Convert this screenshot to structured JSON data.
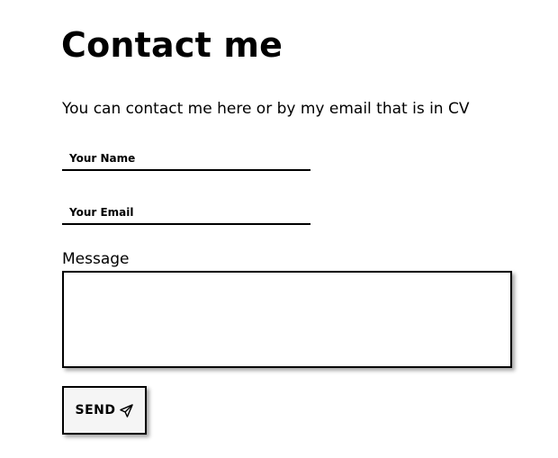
{
  "page": {
    "title": "Contact me",
    "intro": "You can contact me here or by my email that is in CV"
  },
  "form": {
    "name_placeholder": "Your Name",
    "name_value": "",
    "email_placeholder": "Your Email",
    "email_value": "",
    "message_label": "Message",
    "message_value": "",
    "send_label": "SEND",
    "send_icon": "paper-plane-icon"
  }
}
